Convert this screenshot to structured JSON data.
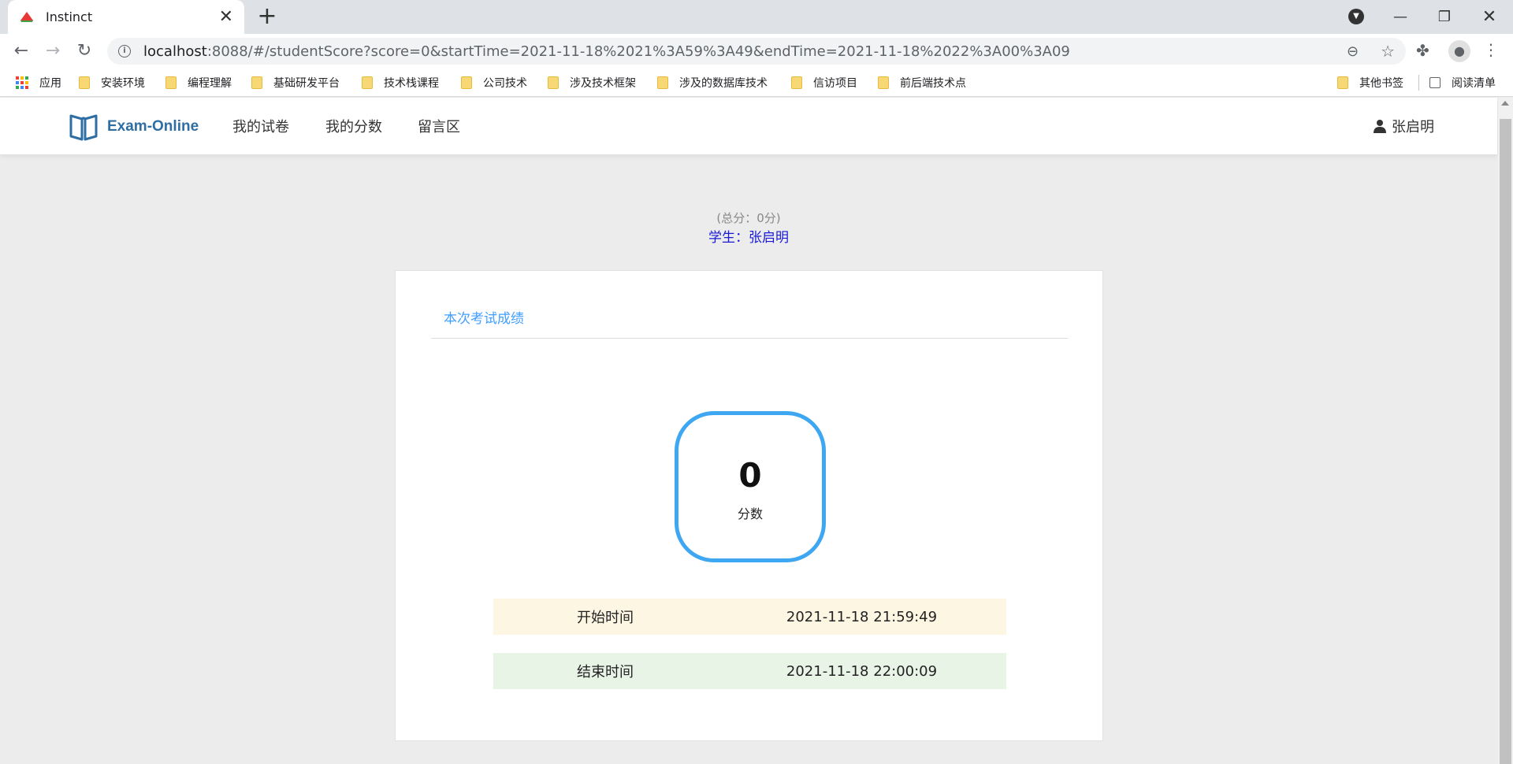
{
  "browser": {
    "tab_title": "Instinct",
    "url_host": "localhost",
    "url_path": ":8088/#/studentScore?score=0&startTime=2021-11-18%2021%3A59%3A49&endTime=2021-11-18%2022%3A00%3A09",
    "bookmarks": [
      {
        "label": "应用",
        "icon": "apps-icon"
      },
      {
        "label": "安装环境",
        "icon": "folder-icon"
      },
      {
        "label": "编程理解",
        "icon": "folder-icon"
      },
      {
        "label": "基础研发平台",
        "icon": "folder-icon"
      },
      {
        "label": "技术栈课程",
        "icon": "folder-icon"
      },
      {
        "label": "公司技术",
        "icon": "folder-icon"
      },
      {
        "label": "涉及技术框架",
        "icon": "folder-icon"
      },
      {
        "label": "涉及的数据库技术",
        "icon": "folder-icon"
      },
      {
        "label": "信访项目",
        "icon": "folder-icon"
      },
      {
        "label": "前后端技术点",
        "icon": "folder-icon"
      }
    ],
    "other_bookmarks": "其他书签",
    "reading_list": "阅读清单"
  },
  "header": {
    "logo_text": "Exam-Online",
    "nav": [
      "我的试卷",
      "我的分数",
      "留言区"
    ],
    "user_name": "张启明"
  },
  "summary": {
    "total": "(总分：0分)",
    "student": "学生：张启明"
  },
  "card": {
    "title": "本次考试成绩",
    "score_value": "0",
    "score_label": "分数",
    "start_label": "开始时间",
    "start_value": "2021-11-18 21:59:49",
    "end_label": "结束时间",
    "end_value": "2021-11-18 22:00:09"
  },
  "colors": {
    "accent_blue": "#409eff",
    "score_ring": "#3fa7f2",
    "logo_blue": "#2f6ea3",
    "start_row_bg": "#fdf6e3",
    "end_row_bg": "#e8f4e6"
  }
}
